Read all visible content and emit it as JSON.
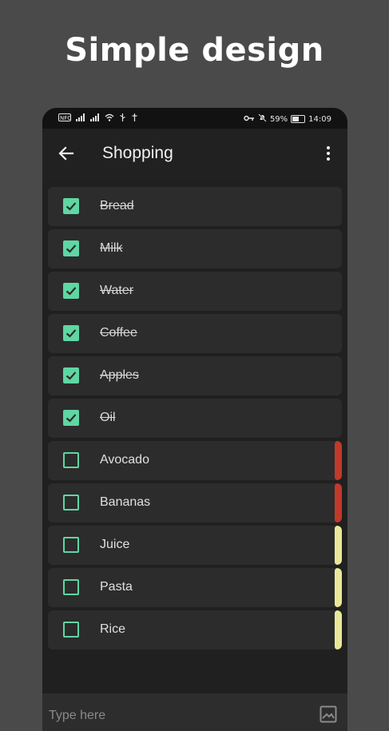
{
  "headline": "Simple design",
  "status_bar": {
    "left_icons": [
      "nfc-icon",
      "sim-signal-icon",
      "signal-icon",
      "wifi-icon",
      "usb-icon"
    ],
    "vpn_key_icon": "key-icon",
    "mute_icon": "bell-off-icon",
    "battery_percent": "59%",
    "time": "14:09"
  },
  "app_bar": {
    "back_icon": "arrow-back-icon",
    "title": "Shopping",
    "menu_icon": "more-vert-icon"
  },
  "items": [
    {
      "label": "Bread",
      "checked": true,
      "priority": null
    },
    {
      "label": "Milk",
      "checked": true,
      "priority": null
    },
    {
      "label": "Water",
      "checked": true,
      "priority": null
    },
    {
      "label": "Coffee",
      "checked": true,
      "priority": null
    },
    {
      "label": "Apples",
      "checked": true,
      "priority": null
    },
    {
      "label": "Oil",
      "checked": true,
      "priority": null
    },
    {
      "label": "Avocado",
      "checked": false,
      "priority": "high"
    },
    {
      "label": "Bananas",
      "checked": false,
      "priority": "high"
    },
    {
      "label": "Juice",
      "checked": false,
      "priority": "medium"
    },
    {
      "label": "Pasta",
      "checked": false,
      "priority": "medium"
    },
    {
      "label": "Rice",
      "checked": false,
      "priority": "medium"
    }
  ],
  "input": {
    "placeholder": "Type here",
    "value": ""
  },
  "colors": {
    "background": "#4a4a4a",
    "accent": "#5fd6a3",
    "priority_high": "#c0392b",
    "priority_medium": "#e8e89a",
    "item_bg": "#2c2c2c"
  }
}
